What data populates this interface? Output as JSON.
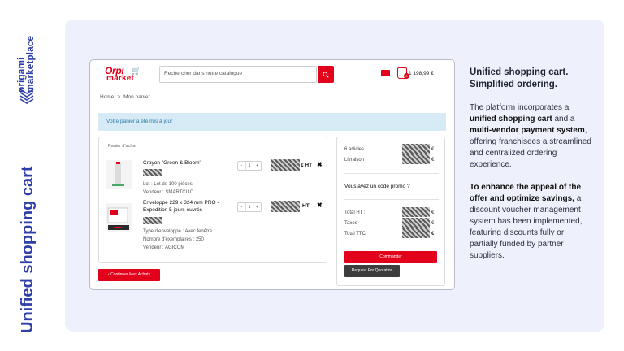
{
  "brand": {
    "name_line1": "origami",
    "name_line2": "marketplace",
    "vertical_title": "Unified shopping cart",
    "accent_color": "#2f3fa8"
  },
  "store": {
    "logo_line1": "Orpi",
    "logo_line2": "market",
    "search_placeholder": "Rechercher dans notre catalogue",
    "search_icon": "search-icon",
    "cart_total": "1 198,99 €",
    "cart_badge": "0",
    "brand_color": "#e2001a"
  },
  "breadcrumb": {
    "home": "Home",
    "separator": ">",
    "current": "Mon panier"
  },
  "alert": {
    "text": "Votre panier a été mis à jour"
  },
  "cart": {
    "title": "Panier d'achat",
    "items": [
      {
        "name": "Crayon \"Green & Bloom\"",
        "qty": "1",
        "minus": "-",
        "plus": "+",
        "price_suffix": "€ HT",
        "remove": "✖",
        "lot": "Lot : Lot de 100 pièces",
        "vendor": "Vendeur : SMARTCLIC"
      },
      {
        "name": "Enveloppe 229 x 324 mm PRO - Expédition 5 jours ouvrés",
        "qty": "1",
        "minus": "-",
        "plus": "+",
        "price_suffix": "HT",
        "remove": "✖",
        "type": "Type d'enveloppe : Avec fenêtre",
        "copies": "Nombre d'exemplaires : 250",
        "vendor": "Vendeur : AGICOM"
      }
    ],
    "continue_label": "Continuer Mes Achats"
  },
  "summary": {
    "articles_label": "6 articles :",
    "shipping_label": "Livraison :",
    "currency": "€",
    "promo_label": "Vous avez un code promo ?",
    "total_ht_label": "Total HT :",
    "taxes_label": "Taxes",
    "total_ttc_label": "Total TTC",
    "order_label": "Commander",
    "quote_label": "Request For Quotation"
  },
  "copy": {
    "title_line1": "Unified shopping cart.",
    "title_line2": "Simplified ordering.",
    "p1_a": "The platform incorporates a ",
    "p1_b": "unified shopping cart",
    "p1_c": " and a ",
    "p1_d": "multi-vendor payment system",
    "p1_e": ", offering franchisees a streamlined and centralized ordering experience.",
    "p2_a": "To enhance the appeal of the offer and optimize savings,",
    "p2_b": " a discount voucher management system has been implemented, featuring discounts fully or partially funded by partner suppliers."
  }
}
